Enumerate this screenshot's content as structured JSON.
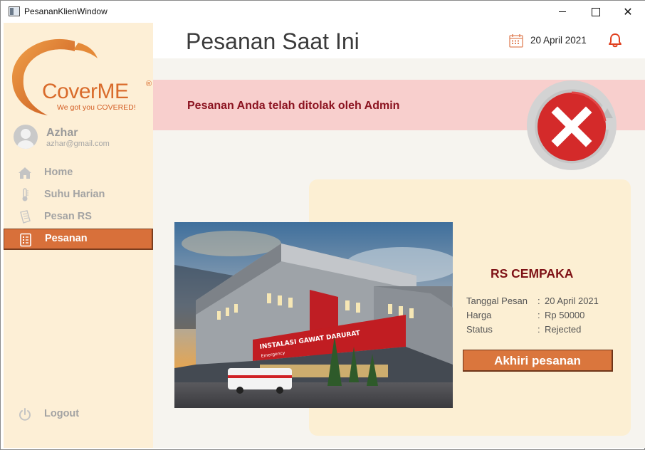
{
  "window": {
    "title": "PesananKlienWindow",
    "controls": {
      "minimize": "—",
      "maximize": "☐",
      "close": "✕"
    }
  },
  "sidebar": {
    "logo": {
      "brand": "CoverME",
      "registered": "®",
      "tagline": "We got you COVERED!"
    },
    "user": {
      "name": "Azhar",
      "email": "azhar@gmail.com"
    },
    "items": [
      {
        "label": "Home",
        "icon": "home-icon"
      },
      {
        "label": "Suhu Harian",
        "icon": "thermometer-icon"
      },
      {
        "label": "Pesan RS",
        "icon": "document-icon"
      },
      {
        "label": "Pesanan",
        "icon": "list-icon",
        "active": true
      }
    ],
    "logout": {
      "label": "Logout",
      "icon": "power-icon"
    }
  },
  "header": {
    "title": "Pesanan Saat Ini",
    "date": "20 April 2021",
    "calendar_icon": "calendar-icon",
    "notification_icon": "bell-icon"
  },
  "banner": {
    "message": "Pesanan Anda telah ditolak oleh Admin",
    "status_icon": "rejected-x-icon"
  },
  "order": {
    "hospital_name": "RS CEMPAKA",
    "image_sign": "INSTALASI GAWAT DARURAT",
    "image_subsign": "Emergency",
    "fields": [
      {
        "label": "Tanggal Pesan",
        "value": "20 April 2021"
      },
      {
        "label": "Harga",
        "value": "Rp 50000"
      },
      {
        "label": "Status",
        "value": "Rejected"
      }
    ],
    "end_button_label": "Akhiri pesanan"
  },
  "colors": {
    "accent": "#d8703a",
    "sidebar_bg": "#fdefd6",
    "banner_bg": "#f8cfcd",
    "banner_text": "#8b1320",
    "hospital_name": "#7e1115",
    "reject_red": "#d42a2a"
  }
}
